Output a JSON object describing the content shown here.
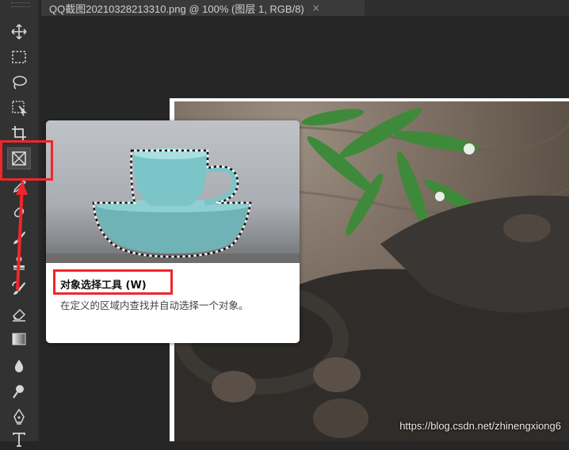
{
  "document_tab": {
    "title": "QQ截图20210328213310.png @ 100% (图层 1, RGB/8)",
    "close_glyph": "×"
  },
  "toolbar": {
    "active_tool": "object-selection-icon",
    "tools": [
      "move-icon",
      "marquee-icon",
      "lasso-icon",
      "quick-selection-icon",
      "crop-icon",
      "object-selection-icon",
      "eyedropper-icon",
      "healing-brush-icon",
      "brush-icon",
      "clone-stamp-icon",
      "history-brush-icon",
      "eraser-icon",
      "gradient-icon",
      "blur-icon",
      "dodge-icon",
      "pen-icon",
      "type-icon"
    ]
  },
  "tooltip": {
    "title": "对象选择工具 (W)",
    "description": "在定义的区域内查找并自动选择一个对象。"
  },
  "watermark": "https://blog.csdn.net/zhinengxiong6",
  "colors": {
    "highlight": "#f0262a",
    "toolbar_bg": "#323232",
    "workspace_bg": "#262626"
  }
}
